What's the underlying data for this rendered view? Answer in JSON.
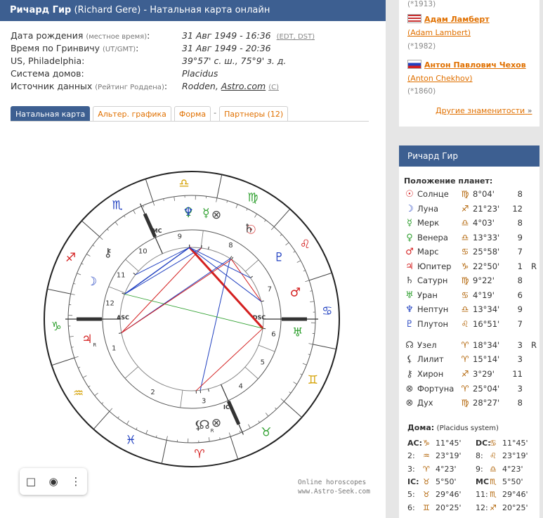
{
  "header": {
    "name": "Ричард Гир",
    "rest": "(Richard Gere) - Натальная карта онлайн"
  },
  "info": {
    "birth_label": "Дата рождения",
    "birth_note": "(местное время)",
    "birth_value": "31 Авг 1949 - 16:36",
    "birth_links": "(EDT, DST)",
    "gmt_label": "Время по Гринвичу",
    "gmt_note": "(UT/GMT)",
    "gmt_value": "31 Авг 1949 - 20:36",
    "place_label": "US, Philadelphia:",
    "place_value": "39°57' с. ш., 75°9' з. д.",
    "houses_label": "Система домов:",
    "houses_value": "Placidus",
    "source_label": "Источник данных",
    "source_note": "(Рейтинг Роддена)",
    "source_value": "Rodden,",
    "source_link": "Astro.com",
    "source_rating": "(C)"
  },
  "tabs": [
    {
      "label": "Натальная карта",
      "active": true
    },
    {
      "label": "Альтер. графика",
      "active": false
    },
    {
      "label": "Форма",
      "active": false
    },
    {
      "label": "Партнеры (12)",
      "active": false
    }
  ],
  "tab_separator": "-",
  "credit": {
    "line1": "Online horoscopes",
    "line2": "www.Astro-Seek.com"
  },
  "famous": [
    {
      "name": "Адам Ламберт",
      "en": "(Adam Lambert)",
      "year": "(*1982)",
      "flag": "us"
    },
    {
      "name": "Антон Павлович Чехов",
      "en": "(Anton Chekhov)",
      "year": "(*1860)",
      "flag": "ru"
    }
  ],
  "famous_more": "Другие знаменитости",
  "famous_top_year": "(*1913)",
  "panel": {
    "title": "Ричард Гир",
    "planets_title": "Положение планет:",
    "planets": [
      {
        "glyph": "☉",
        "name": "Солнце",
        "sign": "♍",
        "deg": "8°04'",
        "house": "8",
        "retro": "",
        "color": "#d42020"
      },
      {
        "glyph": "☽",
        "name": "Луна",
        "sign": "♐",
        "deg": "21°23'",
        "house": "12",
        "retro": "",
        "color": "#2040c0"
      },
      {
        "glyph": "☿",
        "name": "Мерк",
        "sign": "♎",
        "deg": "4°03'",
        "house": "8",
        "retro": "",
        "color": "#30a030"
      },
      {
        "glyph": "♀",
        "name": "Венера",
        "sign": "♎",
        "deg": "13°33'",
        "house": "9",
        "retro": "",
        "color": "#30a030"
      },
      {
        "glyph": "♂",
        "name": "Марс",
        "sign": "♋",
        "deg": "25°58'",
        "house": "7",
        "retro": "",
        "color": "#d42020"
      },
      {
        "glyph": "♃",
        "name": "Юпитер",
        "sign": "♑",
        "deg": "22°50'",
        "house": "1",
        "retro": "R",
        "color": "#d42020"
      },
      {
        "glyph": "♄",
        "name": "Сатурн",
        "sign": "♍",
        "deg": "9°22'",
        "house": "8",
        "retro": "",
        "color": "#444444"
      },
      {
        "glyph": "♅",
        "name": "Уран",
        "sign": "♋",
        "deg": "4°19'",
        "house": "6",
        "retro": "",
        "color": "#30a030"
      },
      {
        "glyph": "♆",
        "name": "Нептун",
        "sign": "♎",
        "deg": "13°34'",
        "house": "9",
        "retro": "",
        "color": "#2040c0"
      },
      {
        "glyph": "♇",
        "name": "Плутон",
        "sign": "♌",
        "deg": "16°51'",
        "house": "7",
        "retro": "",
        "color": "#2040c0"
      },
      {
        "glyph": "☊",
        "name": "Узел",
        "sign": "♈",
        "deg": "18°34'",
        "house": "3",
        "retro": "R",
        "color": "#444444"
      },
      {
        "glyph": "⚸",
        "name": "Лилит",
        "sign": "♈",
        "deg": "15°14'",
        "house": "3",
        "retro": "",
        "color": "#444444"
      },
      {
        "glyph": "⚷",
        "name": "Хирон",
        "sign": "♐",
        "deg": "3°29'",
        "house": "11",
        "retro": "",
        "color": "#444444"
      },
      {
        "glyph": "⊗",
        "name": "Фортуна",
        "sign": "♈",
        "deg": "25°04'",
        "house": "3",
        "retro": "",
        "color": "#444444"
      },
      {
        "glyph": "⊗",
        "name": "Дух",
        "sign": "♍",
        "deg": "28°27'",
        "house": "8",
        "retro": "",
        "color": "#444444"
      }
    ],
    "houses_title": "Дома:",
    "houses_note": "(Placidus system)",
    "houses": [
      {
        "l1": "AC:",
        "s1": "♑",
        "d1": "11°45'",
        "l2": "DC:",
        "s2": "♋",
        "d2": "11°45'",
        "bold": true
      },
      {
        "l1": "2:",
        "s1": "♒",
        "d1": "23°19'",
        "l2": "8:",
        "s2": "♌",
        "d2": "23°19'",
        "bold": false
      },
      {
        "l1": "3:",
        "s1": "♈",
        "d1": "4°23'",
        "l2": "9:",
        "s2": "♎",
        "d2": "4°23'",
        "bold": false
      },
      {
        "l1": "IC:",
        "s1": "♉",
        "d1": "5°50'",
        "l2": "MC",
        "s2": "♏",
        "d2": "5°50'",
        "bold": true
      },
      {
        "l1": "5:",
        "s1": "♉",
        "d1": "29°46'",
        "l2": "11:",
        "s2": "♏",
        "d2": "29°46'",
        "bold": false
      },
      {
        "l1": "6:",
        "s1": "♊",
        "d1": "20°25'",
        "l2": "12:",
        "s2": "♐",
        "d2": "20°25'",
        "bold": false
      }
    ]
  },
  "wheel": {
    "signs_order": [
      "♈",
      "♉",
      "♊",
      "♋",
      "♌",
      "♍",
      "♎",
      "♏",
      "♐",
      "♑",
      "♒",
      "♓"
    ],
    "sign_colors": [
      "#d42020",
      "#30a030",
      "#d4a000",
      "#2040c0",
      "#d42020",
      "#30a030",
      "#d4a000",
      "#2040c0",
      "#d42020",
      "#30a030",
      "#d4a000",
      "#2040c0"
    ],
    "asc_label": "ASC",
    "dsc_label": "DSC",
    "mc_label": "MC",
    "ic_label": "IC",
    "house_numbers": [
      "1",
      "2",
      "3",
      "4",
      "5",
      "6",
      "7",
      "8",
      "9",
      "10",
      "11",
      "12"
    ],
    "retro_mark": "R"
  },
  "toolbar": {
    "bookmark_icon": "bookmark-icon",
    "camera_icon": "camera-icon",
    "more_icon": "more-icon"
  }
}
